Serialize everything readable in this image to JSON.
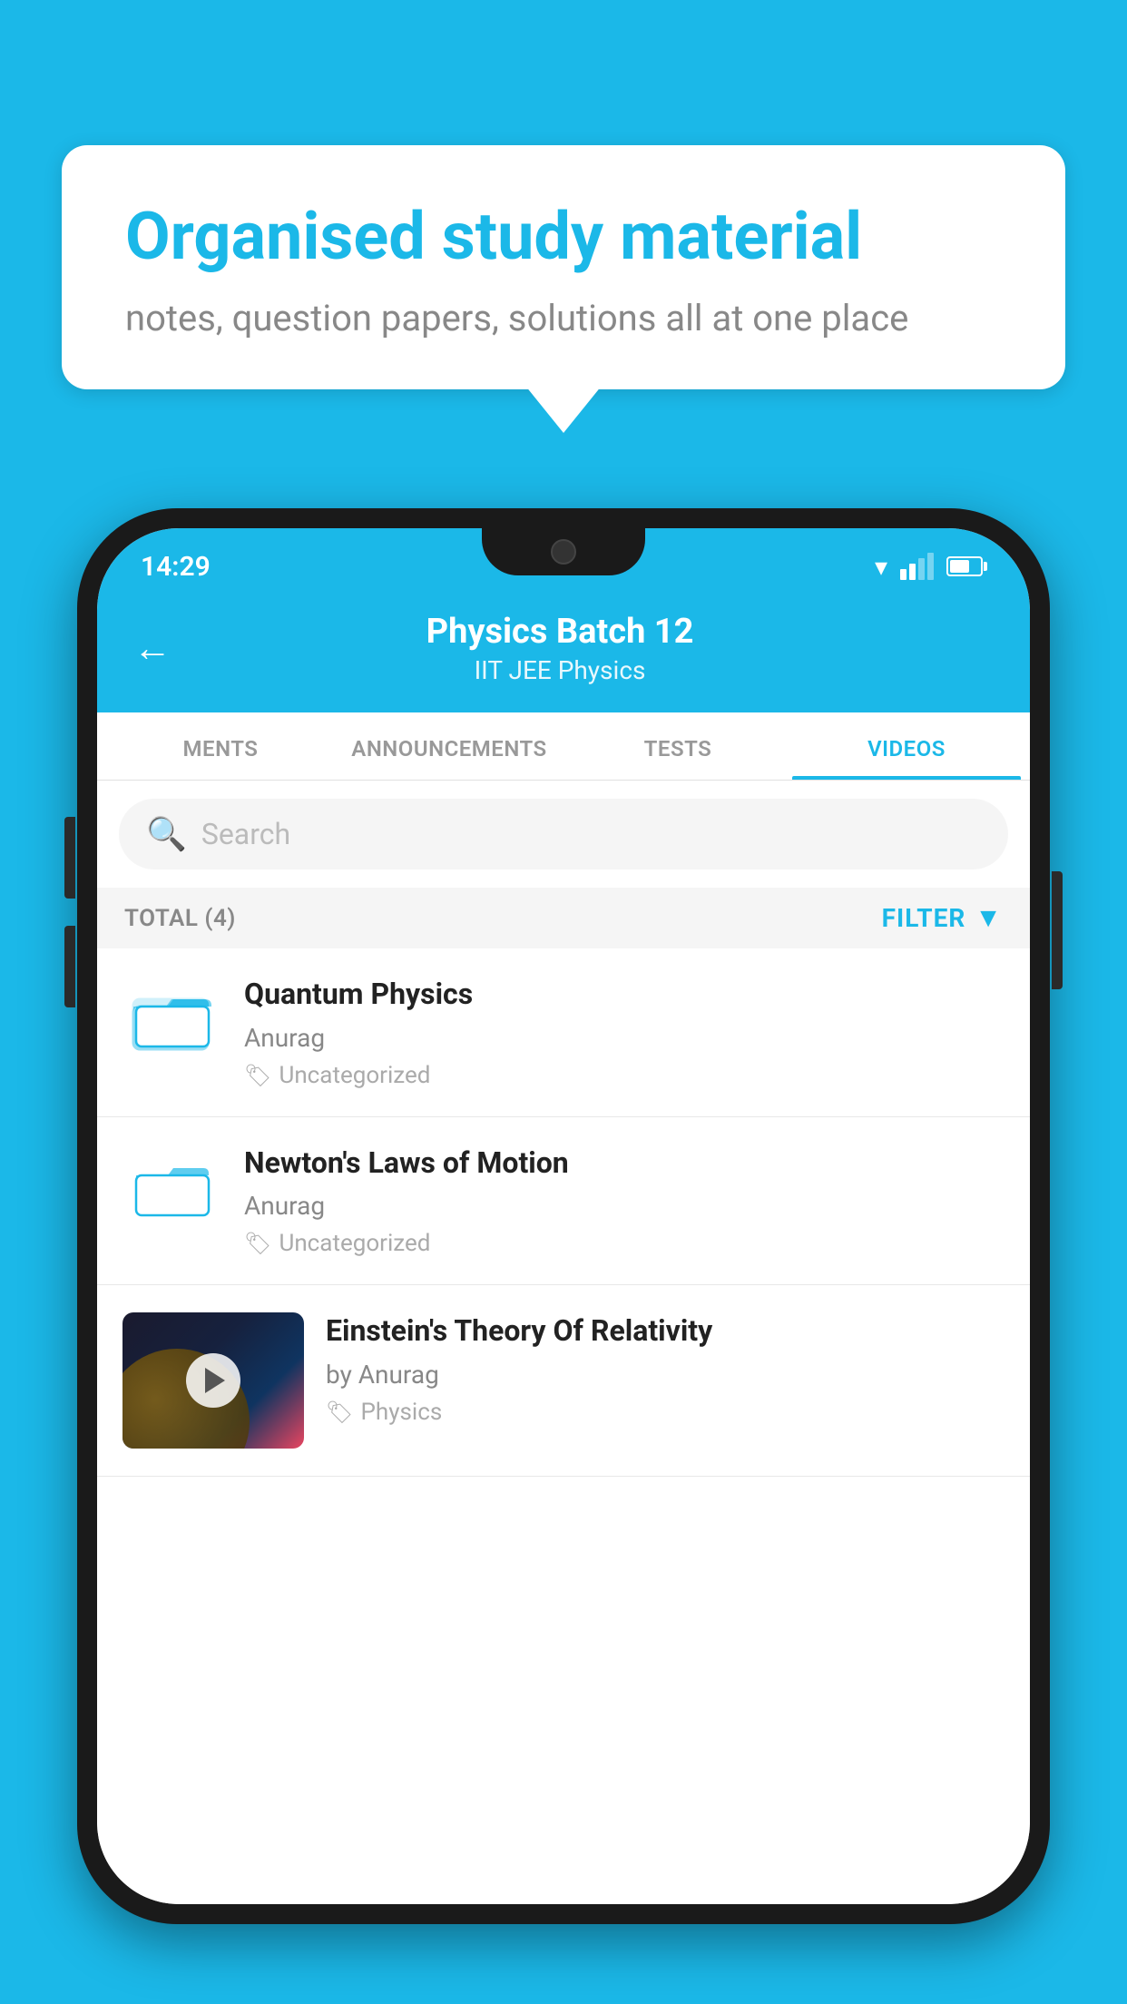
{
  "background": "#1bb8e8",
  "bubble": {
    "title": "Organised study material",
    "subtitle": "notes, question papers, solutions all at one place"
  },
  "status_bar": {
    "time": "14:29"
  },
  "header": {
    "title": "Physics Batch 12",
    "subtitle": "IIT JEE   Physics"
  },
  "tabs": [
    {
      "id": "ments",
      "label": "MENTS",
      "active": false
    },
    {
      "id": "announcements",
      "label": "ANNOUNCEMENTS",
      "active": false
    },
    {
      "id": "tests",
      "label": "TESTS",
      "active": false
    },
    {
      "id": "videos",
      "label": "VIDEOS",
      "active": true
    }
  ],
  "search": {
    "placeholder": "Search"
  },
  "filter_bar": {
    "total_label": "TOTAL (4)",
    "filter_label": "FILTER"
  },
  "videos": [
    {
      "id": 1,
      "title": "Quantum Physics",
      "author": "Anurag",
      "tag": "Uncategorized",
      "type": "folder"
    },
    {
      "id": 2,
      "title": "Newton's Laws of Motion",
      "author": "Anurag",
      "tag": "Uncategorized",
      "type": "folder"
    },
    {
      "id": 3,
      "title": "Einstein's Theory Of Relativity",
      "author": "by Anurag",
      "tag": "Physics",
      "type": "video"
    }
  ]
}
